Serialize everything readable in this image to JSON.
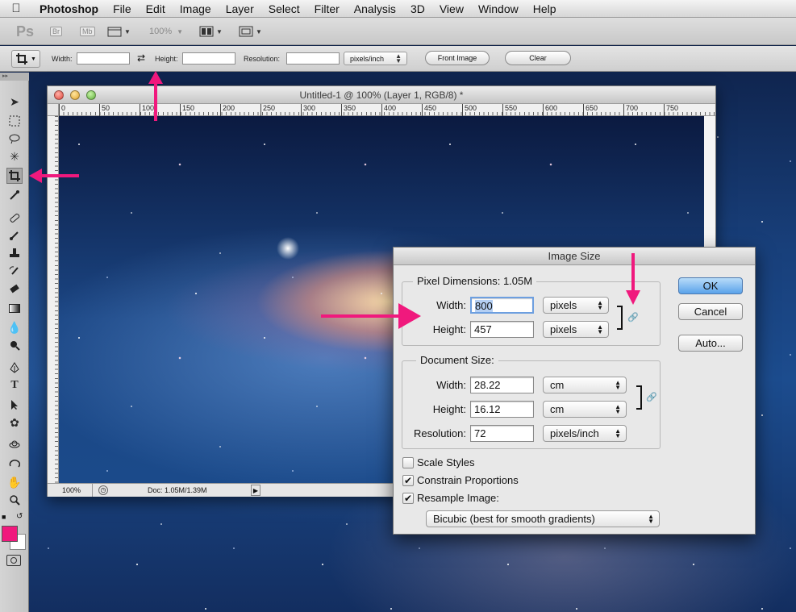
{
  "menubar": {
    "apple_icon": "apple-logo-icon",
    "items": [
      "Photoshop",
      "File",
      "Edit",
      "Image",
      "Layer",
      "Select",
      "Filter",
      "Analysis",
      "3D",
      "View",
      "Window",
      "Help"
    ]
  },
  "appbar": {
    "ps_label": "Ps",
    "br_label": "Br",
    "mb_label": "Mb",
    "zoom": "100%"
  },
  "options_bar": {
    "width_label": "Width:",
    "width_value": "",
    "height_label": "Height:",
    "height_value": "",
    "resolution_label": "Resolution:",
    "resolution_value": "",
    "resolution_unit": "pixels/inch",
    "front_image_button": "Front Image",
    "clear_button": "Clear"
  },
  "toolbox": {
    "active_tool": "crop-tool",
    "foreground_color": "#f0197d",
    "background_color": "#ffffff",
    "tools": [
      "move-tool",
      "marquee-tool",
      "lasso-tool",
      "magic-wand-tool",
      "crop-tool",
      "eyedropper-tool",
      "healing-brush-tool",
      "brush-tool",
      "clone-stamp-tool",
      "history-brush-tool",
      "eraser-tool",
      "gradient-tool",
      "blur-tool",
      "dodge-tool",
      "pen-tool",
      "type-tool",
      "path-selection-tool",
      "custom-shape-tool",
      "3d-rotate-tool",
      "3d-orbit-tool",
      "hand-tool",
      "zoom-tool"
    ]
  },
  "document": {
    "title": "Untitled-1 @ 100% (Layer 1, RGB/8) *",
    "ruler_marks": [
      "0",
      "50",
      "100",
      "150",
      "200",
      "250",
      "300",
      "350",
      "400",
      "450",
      "500",
      "550",
      "600",
      "650",
      "700",
      "750"
    ],
    "zoom": "100%",
    "doc_info": "Doc: 1.05M/1.39M"
  },
  "dialog": {
    "title": "Image Size",
    "pixel_dimensions_label": "Pixel Dimensions:",
    "pixel_dimensions_value": "1.05M",
    "pixel_width_label": "Width:",
    "pixel_width_value": "800",
    "pixel_width_unit": "pixels",
    "pixel_height_label": "Height:",
    "pixel_height_value": "457",
    "pixel_height_unit": "pixels",
    "document_size_label": "Document Size:",
    "doc_width_label": "Width:",
    "doc_width_value": "28.22",
    "doc_width_unit": "cm",
    "doc_height_label": "Height:",
    "doc_height_value": "16.12",
    "doc_height_unit": "cm",
    "resolution_label": "Resolution:",
    "resolution_value": "72",
    "resolution_unit": "pixels/inch",
    "scale_styles_label": "Scale Styles",
    "scale_styles_checked": false,
    "constrain_label": "Constrain Proportions",
    "constrain_checked": true,
    "resample_label": "Resample Image:",
    "resample_checked": true,
    "resample_method": "Bicubic (best for smooth gradients)",
    "ok_button": "OK",
    "cancel_button": "Cancel",
    "auto_button": "Auto..."
  },
  "annotation_color": "#f0197d"
}
